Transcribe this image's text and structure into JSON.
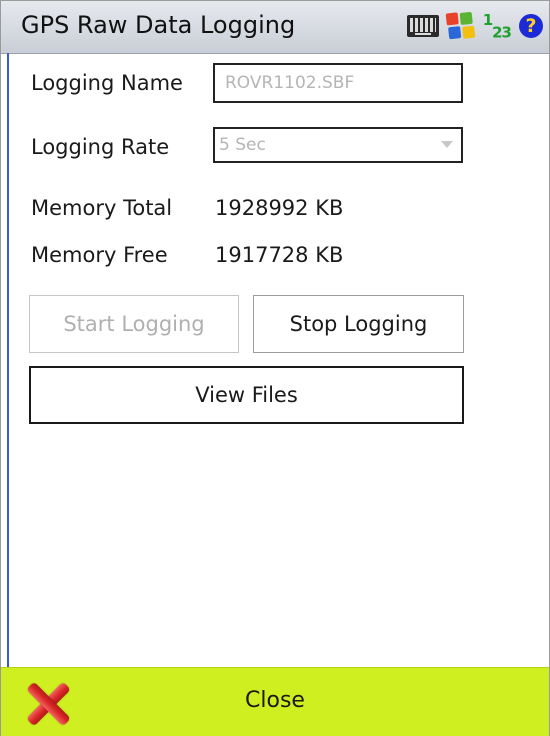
{
  "window": {
    "title": "GPS Raw Data Logging"
  },
  "tray": {
    "num_icon_1": "1",
    "num_icon_23": "23",
    "help_glyph": "?"
  },
  "form": {
    "logging_name_label": "Logging Name",
    "logging_name_value": "ROVR1102.SBF",
    "logging_rate_label": "Logging Rate",
    "logging_rate_value": "5 Sec",
    "memory_total_label": "Memory Total",
    "memory_total_value": "1928992 KB",
    "memory_free_label": "Memory Free",
    "memory_free_value": "1917728 KB"
  },
  "buttons": {
    "start_logging": "Start Logging",
    "stop_logging": "Stop Logging",
    "view_files": "View Files"
  },
  "bottom_bar": {
    "close_label": "Close"
  },
  "colors": {
    "accent_green": "#cfef20",
    "close_red": "#d72424",
    "help_blue": "#1c2bd6"
  },
  "icons": [
    "keyboard-icon",
    "windows-flag-icon",
    "input-mode-123-icon",
    "help-icon",
    "close-x-icon"
  ]
}
